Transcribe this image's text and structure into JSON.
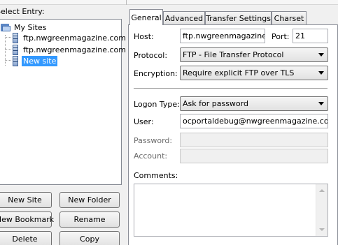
{
  "left": {
    "select_entry_label": "Select Entry:",
    "tree": {
      "root": "My Sites",
      "items": [
        {
          "label": "ftp.nwgreenmagazine.com",
          "selected": false
        },
        {
          "label": "ftp.nwgreenmagazine.com",
          "selected": false
        },
        {
          "label": "New site",
          "selected": true
        }
      ]
    },
    "buttons": {
      "new_site": "New Site",
      "new_folder": "New Folder",
      "new_bookmark": "New Bookmark",
      "rename": "Rename",
      "delete": "Delete",
      "copy": "Copy"
    }
  },
  "tabs": [
    "General",
    "Advanced",
    "Transfer Settings",
    "Charset"
  ],
  "active_tab": "General",
  "general": {
    "host_label": "Host:",
    "host_value": "ftp.nwgreenmagazine.co",
    "port_label": "Port:",
    "port_value": "21",
    "protocol_label": "Protocol:",
    "protocol_value": "FTP - File Transfer Protocol",
    "encryption_label": "Encryption:",
    "encryption_value": "Require explicit FTP over TLS",
    "logon_type_label": "Logon Type:",
    "logon_type_value": "Ask for password",
    "user_label": "User:",
    "user_value": "ocportaldebug@nwgreenmagazine.com",
    "password_label": "Password:",
    "password_value": "",
    "account_label": "Account:",
    "account_value": "",
    "comments_label": "Comments:",
    "comments_value": ""
  },
  "colors": {
    "selection": "#3399ff",
    "window_bg": "#f0f0f0"
  }
}
